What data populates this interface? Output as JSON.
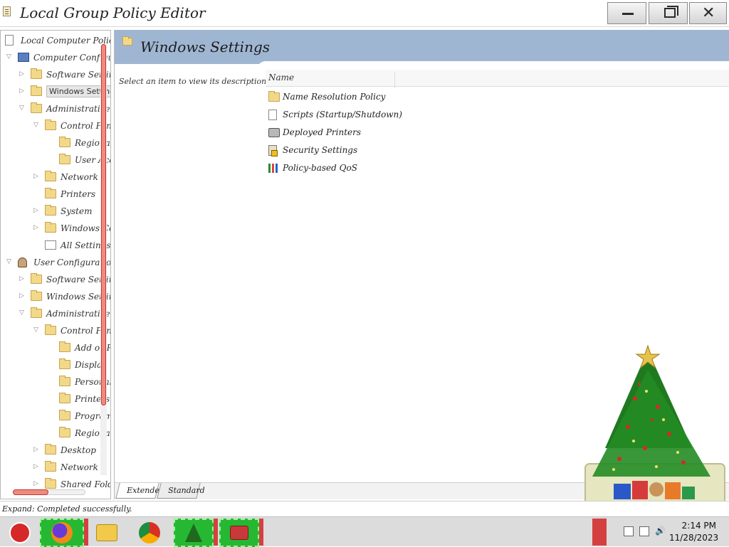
{
  "window": {
    "title": "Local Group Policy Editor"
  },
  "tree": {
    "items": [
      {
        "label": "Local Computer Policy",
        "icon": "policy-doc-icon"
      },
      {
        "label": "Computer Configuration",
        "icon": "computer-icon"
      },
      {
        "label": "Software Settings",
        "icon": "folder-icon"
      },
      {
        "label": "Windows Settings",
        "icon": "folder-icon"
      },
      {
        "label": "Administrative Templates",
        "icon": "folder-icon"
      },
      {
        "label": "Control Panel",
        "icon": "folder-icon"
      },
      {
        "label": "Regional",
        "icon": "folder-icon"
      },
      {
        "label": "User Accounts",
        "icon": "folder-icon"
      },
      {
        "label": "Network",
        "icon": "folder-icon"
      },
      {
        "label": "Printers",
        "icon": "folder-icon"
      },
      {
        "label": "System",
        "icon": "folder-icon"
      },
      {
        "label": "Windows Components",
        "icon": "folder-icon"
      },
      {
        "label": "All Settings",
        "icon": "all-settings-icon"
      },
      {
        "label": "User Configuration",
        "icon": "user-icon"
      },
      {
        "label": "Software Settings",
        "icon": "folder-icon"
      },
      {
        "label": "Windows Settings",
        "icon": "folder-icon"
      },
      {
        "label": "Administrative Templates",
        "icon": "folder-icon"
      },
      {
        "label": "Control Panel",
        "icon": "folder-icon"
      },
      {
        "label": "Add or Remove Programs",
        "icon": "folder-icon"
      },
      {
        "label": "Display",
        "icon": "folder-icon"
      },
      {
        "label": "Personalization",
        "icon": "folder-icon"
      },
      {
        "label": "Printers",
        "icon": "folder-icon"
      },
      {
        "label": "Programs",
        "icon": "folder-icon"
      },
      {
        "label": "Regional",
        "icon": "folder-icon"
      },
      {
        "label": "Desktop",
        "icon": "folder-icon"
      },
      {
        "label": "Network",
        "icon": "folder-icon"
      },
      {
        "label": "Shared Folders",
        "icon": "folder-icon"
      }
    ]
  },
  "details": {
    "header_title": "Windows Settings",
    "description": "Select an item to view its description.",
    "column_name": "Name",
    "items": [
      {
        "label": "Name Resolution Policy",
        "icon": "folder-icon"
      },
      {
        "label": "Scripts (Startup/Shutdown)",
        "icon": "script-icon"
      },
      {
        "label": "Deployed Printers",
        "icon": "printer-icon"
      },
      {
        "label": "Security Settings",
        "icon": "security-icon"
      },
      {
        "label": "Policy-based QoS",
        "icon": "chart-bars-icon"
      }
    ],
    "tabs": {
      "extended": "Extended",
      "standard": "Standard"
    }
  },
  "status": {
    "text": "Expand: Completed successfully."
  },
  "taskbar": {
    "time": "2:14 PM",
    "date": "11/28/2023"
  },
  "colors": {
    "header_bg": "#9fb6d2",
    "taskbar_green": "#26b832",
    "scroll_thumb": "#f08a80"
  }
}
